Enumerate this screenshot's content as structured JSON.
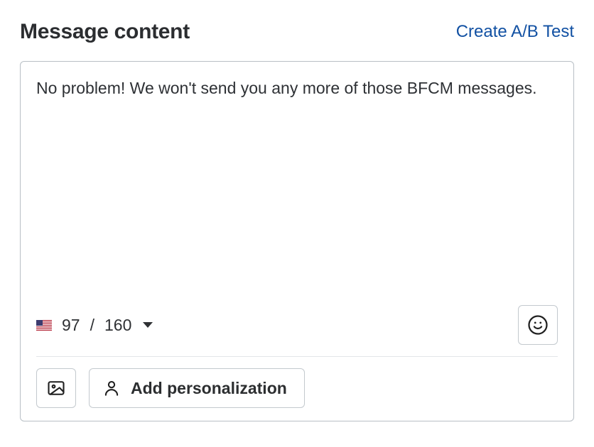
{
  "header": {
    "title": "Message content",
    "ab_test_link": "Create A/B Test"
  },
  "message": {
    "text": "No problem! We won't send you any more of those BFCM messages.",
    "char_count": "97",
    "char_separator": " / ",
    "char_limit": "160",
    "country": "US"
  },
  "toolbar": {
    "personalization_label": "Add personalization"
  }
}
